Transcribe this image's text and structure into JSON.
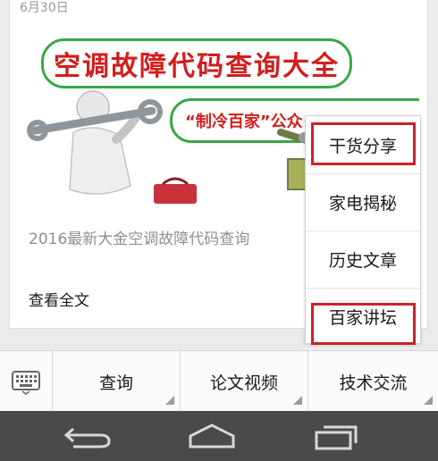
{
  "article": {
    "date": "6月30日",
    "cover": {
      "headline": "空调故障代码查询大全",
      "subline": "“制冷百家”公众"
    },
    "summary": "2016最新大金空调故障代码查询",
    "read_more": "查看全文"
  },
  "menu_bar": {
    "items": [
      {
        "label": "查询"
      },
      {
        "label": "论文视频"
      },
      {
        "label": "技术交流"
      }
    ]
  },
  "popup_menu": {
    "items": [
      {
        "label": "干货分享",
        "highlighted": true
      },
      {
        "label": "家电揭秘",
        "highlighted": false
      },
      {
        "label": "历史文章",
        "highlighted": false
      },
      {
        "label": "百家讲坛",
        "highlighted": true
      }
    ]
  },
  "colors": {
    "headline_red": "#d31d1d",
    "bubble_green": "#39a845",
    "highlight_red": "#cc2227",
    "nav_bar": "#4a4a4a"
  },
  "icons": {
    "keyboard": "keyboard-icon",
    "back": "back-icon",
    "home": "home-icon",
    "recent": "recent-apps-icon"
  }
}
